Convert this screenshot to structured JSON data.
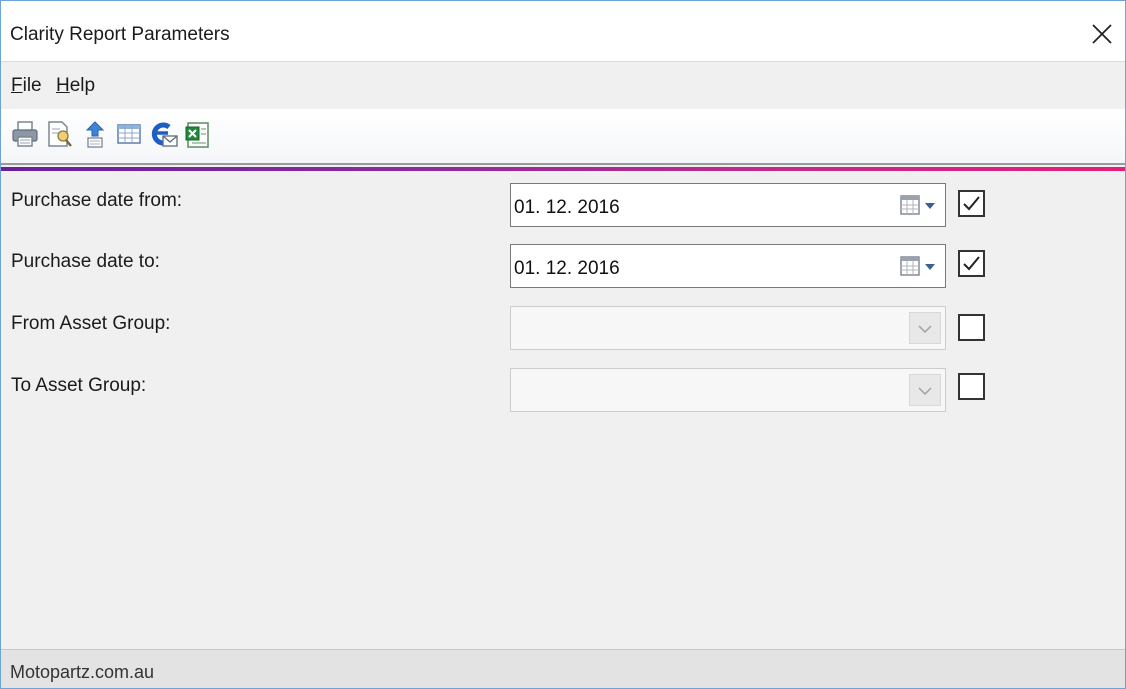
{
  "window": {
    "title": "Clarity Report Parameters",
    "close_label": "×"
  },
  "menu": {
    "items": [
      {
        "label_underlined": "F",
        "label_rest": "ile"
      },
      {
        "label_underlined": "H",
        "label_rest": "elp"
      }
    ]
  },
  "toolbar": {
    "icons": [
      "print-icon",
      "print-preview-icon",
      "export-icon",
      "table-view-icon",
      "email-icon",
      "excel-export-icon"
    ]
  },
  "colors": {
    "accent_start": "#6c1e9c",
    "accent_end": "#e51d7a",
    "window_border": "#6fa3d6"
  },
  "params": [
    {
      "label": "Purchase date from:",
      "value": "01. 12. 2016",
      "type": "date",
      "checked": true,
      "enabled": true
    },
    {
      "label": "Purchase date to:",
      "value": "01. 12. 2016",
      "type": "date",
      "checked": true,
      "enabled": true
    },
    {
      "label": "From Asset Group:",
      "value": "",
      "type": "dropdown",
      "checked": false,
      "enabled": false
    },
    {
      "label": "To Asset Group:",
      "value": "",
      "type": "dropdown",
      "checked": false,
      "enabled": false
    }
  ],
  "status": {
    "text": "Motopartz.com.au"
  }
}
